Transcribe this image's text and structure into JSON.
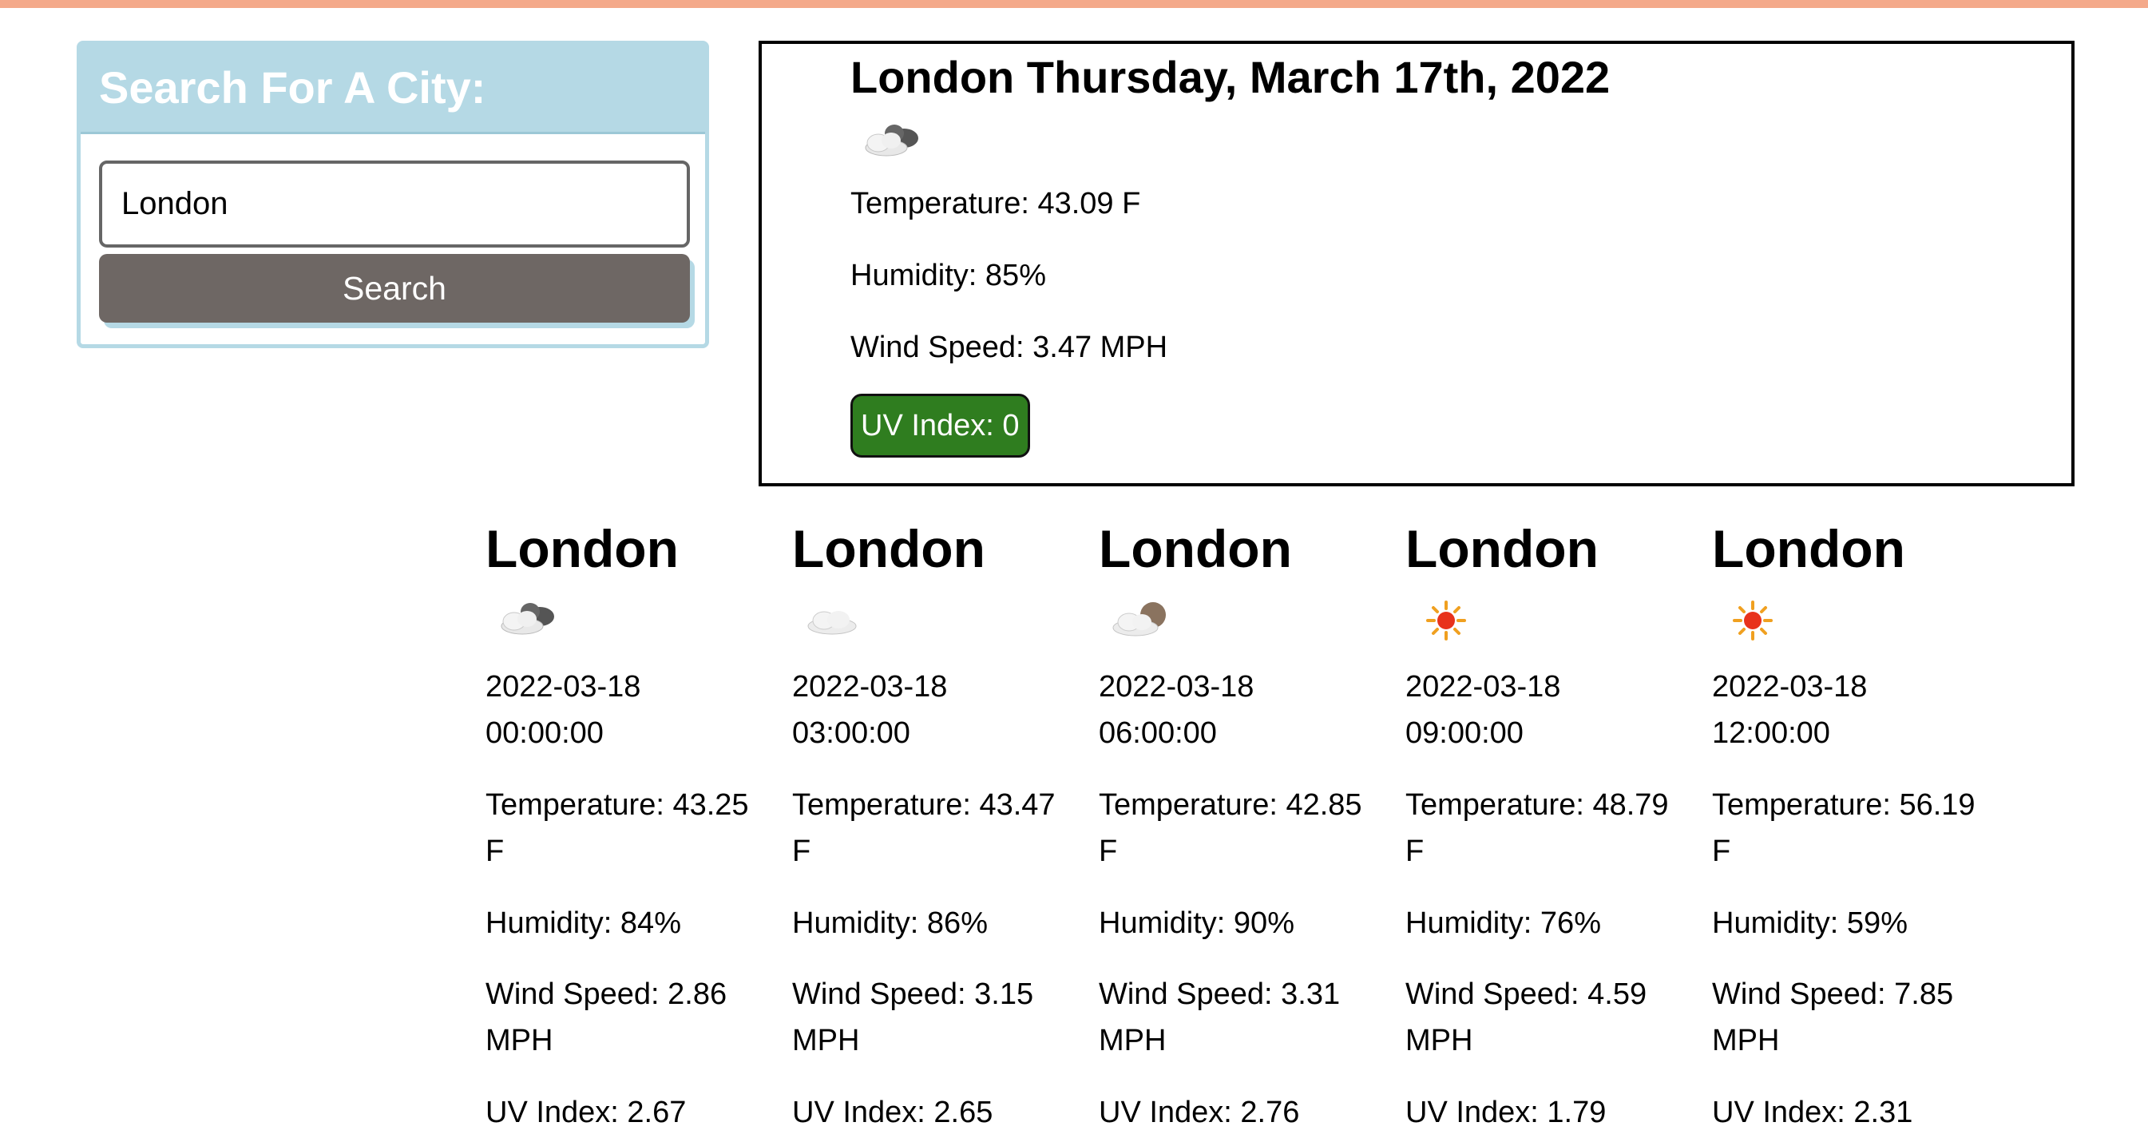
{
  "search": {
    "title": "Search For A City:",
    "input_value": "London",
    "button_label": "Search"
  },
  "current": {
    "title": "London Thursday, March 17th, 2022",
    "icon": "broken-clouds-icon",
    "temperature": "Temperature: 43.09 F",
    "humidity": "Humidity: 85%",
    "wind": "Wind Speed: 3.47 MPH",
    "uv": "UV Index: 0",
    "uv_color": "#2f7d1f"
  },
  "forecast": [
    {
      "city": "London",
      "icon": "broken-clouds-icon",
      "datetime": "2022-03-18 00:00:00",
      "temperature": "Temperature: 43.25 F",
      "humidity": "Humidity: 84%",
      "wind": "Wind Speed: 2.86 MPH",
      "uv": "UV Index: 2.67"
    },
    {
      "city": "London",
      "icon": "cloud-icon",
      "datetime": "2022-03-18 03:00:00",
      "temperature": "Temperature: 43.47 F",
      "humidity": "Humidity: 86%",
      "wind": "Wind Speed: 3.15 MPH",
      "uv": "UV Index: 2.65"
    },
    {
      "city": "London",
      "icon": "cloud-night-icon",
      "datetime": "2022-03-18 06:00:00",
      "temperature": "Temperature: 42.85 F",
      "humidity": "Humidity: 90%",
      "wind": "Wind Speed: 3.31 MPH",
      "uv": "UV Index: 2.76"
    },
    {
      "city": "London",
      "icon": "sun-icon",
      "datetime": "2022-03-18 09:00:00",
      "temperature": "Temperature: 48.79 F",
      "humidity": "Humidity: 76%",
      "wind": "Wind Speed: 4.59 MPH",
      "uv": "UV Index: 1.79"
    },
    {
      "city": "London",
      "icon": "sun-icon",
      "datetime": "2022-03-18 12:00:00",
      "temperature": "Temperature: 56.19 F",
      "humidity": "Humidity: 59%",
      "wind": "Wind Speed: 7.85 MPH",
      "uv": "UV Index: 2.31"
    }
  ],
  "colors": {
    "top_bar": "#f4a98a",
    "search_header": "#b5d9e5",
    "search_button": "#6e6764"
  }
}
